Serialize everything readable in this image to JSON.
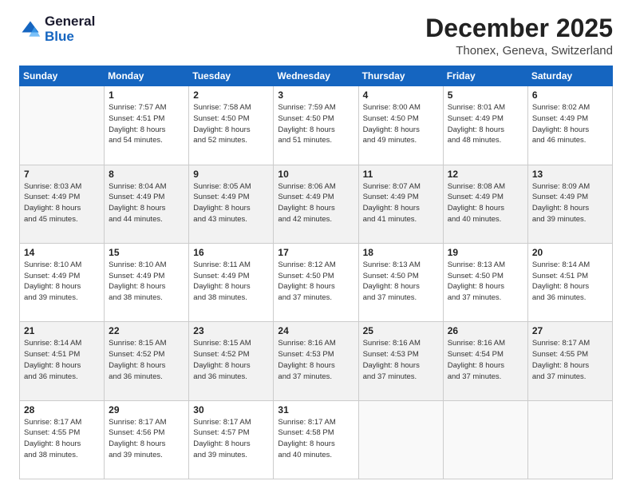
{
  "header": {
    "logo_line1": "General",
    "logo_line2": "Blue",
    "month_title": "December 2025",
    "subtitle": "Thonex, Geneva, Switzerland"
  },
  "weekdays": [
    "Sunday",
    "Monday",
    "Tuesday",
    "Wednesday",
    "Thursday",
    "Friday",
    "Saturday"
  ],
  "weeks": [
    [
      {
        "day": "",
        "info": ""
      },
      {
        "day": "1",
        "info": "Sunrise: 7:57 AM\nSunset: 4:51 PM\nDaylight: 8 hours\nand 54 minutes."
      },
      {
        "day": "2",
        "info": "Sunrise: 7:58 AM\nSunset: 4:50 PM\nDaylight: 8 hours\nand 52 minutes."
      },
      {
        "day": "3",
        "info": "Sunrise: 7:59 AM\nSunset: 4:50 PM\nDaylight: 8 hours\nand 51 minutes."
      },
      {
        "day": "4",
        "info": "Sunrise: 8:00 AM\nSunset: 4:50 PM\nDaylight: 8 hours\nand 49 minutes."
      },
      {
        "day": "5",
        "info": "Sunrise: 8:01 AM\nSunset: 4:49 PM\nDaylight: 8 hours\nand 48 minutes."
      },
      {
        "day": "6",
        "info": "Sunrise: 8:02 AM\nSunset: 4:49 PM\nDaylight: 8 hours\nand 46 minutes."
      }
    ],
    [
      {
        "day": "7",
        "info": "Sunrise: 8:03 AM\nSunset: 4:49 PM\nDaylight: 8 hours\nand 45 minutes."
      },
      {
        "day": "8",
        "info": "Sunrise: 8:04 AM\nSunset: 4:49 PM\nDaylight: 8 hours\nand 44 minutes."
      },
      {
        "day": "9",
        "info": "Sunrise: 8:05 AM\nSunset: 4:49 PM\nDaylight: 8 hours\nand 43 minutes."
      },
      {
        "day": "10",
        "info": "Sunrise: 8:06 AM\nSunset: 4:49 PM\nDaylight: 8 hours\nand 42 minutes."
      },
      {
        "day": "11",
        "info": "Sunrise: 8:07 AM\nSunset: 4:49 PM\nDaylight: 8 hours\nand 41 minutes."
      },
      {
        "day": "12",
        "info": "Sunrise: 8:08 AM\nSunset: 4:49 PM\nDaylight: 8 hours\nand 40 minutes."
      },
      {
        "day": "13",
        "info": "Sunrise: 8:09 AM\nSunset: 4:49 PM\nDaylight: 8 hours\nand 39 minutes."
      }
    ],
    [
      {
        "day": "14",
        "info": "Sunrise: 8:10 AM\nSunset: 4:49 PM\nDaylight: 8 hours\nand 39 minutes."
      },
      {
        "day": "15",
        "info": "Sunrise: 8:10 AM\nSunset: 4:49 PM\nDaylight: 8 hours\nand 38 minutes."
      },
      {
        "day": "16",
        "info": "Sunrise: 8:11 AM\nSunset: 4:49 PM\nDaylight: 8 hours\nand 38 minutes."
      },
      {
        "day": "17",
        "info": "Sunrise: 8:12 AM\nSunset: 4:50 PM\nDaylight: 8 hours\nand 37 minutes."
      },
      {
        "day": "18",
        "info": "Sunrise: 8:13 AM\nSunset: 4:50 PM\nDaylight: 8 hours\nand 37 minutes."
      },
      {
        "day": "19",
        "info": "Sunrise: 8:13 AM\nSunset: 4:50 PM\nDaylight: 8 hours\nand 37 minutes."
      },
      {
        "day": "20",
        "info": "Sunrise: 8:14 AM\nSunset: 4:51 PM\nDaylight: 8 hours\nand 36 minutes."
      }
    ],
    [
      {
        "day": "21",
        "info": "Sunrise: 8:14 AM\nSunset: 4:51 PM\nDaylight: 8 hours\nand 36 minutes."
      },
      {
        "day": "22",
        "info": "Sunrise: 8:15 AM\nSunset: 4:52 PM\nDaylight: 8 hours\nand 36 minutes."
      },
      {
        "day": "23",
        "info": "Sunrise: 8:15 AM\nSunset: 4:52 PM\nDaylight: 8 hours\nand 36 minutes."
      },
      {
        "day": "24",
        "info": "Sunrise: 8:16 AM\nSunset: 4:53 PM\nDaylight: 8 hours\nand 37 minutes."
      },
      {
        "day": "25",
        "info": "Sunrise: 8:16 AM\nSunset: 4:53 PM\nDaylight: 8 hours\nand 37 minutes."
      },
      {
        "day": "26",
        "info": "Sunrise: 8:16 AM\nSunset: 4:54 PM\nDaylight: 8 hours\nand 37 minutes."
      },
      {
        "day": "27",
        "info": "Sunrise: 8:17 AM\nSunset: 4:55 PM\nDaylight: 8 hours\nand 37 minutes."
      }
    ],
    [
      {
        "day": "28",
        "info": "Sunrise: 8:17 AM\nSunset: 4:55 PM\nDaylight: 8 hours\nand 38 minutes."
      },
      {
        "day": "29",
        "info": "Sunrise: 8:17 AM\nSunset: 4:56 PM\nDaylight: 8 hours\nand 39 minutes."
      },
      {
        "day": "30",
        "info": "Sunrise: 8:17 AM\nSunset: 4:57 PM\nDaylight: 8 hours\nand 39 minutes."
      },
      {
        "day": "31",
        "info": "Sunrise: 8:17 AM\nSunset: 4:58 PM\nDaylight: 8 hours\nand 40 minutes."
      },
      {
        "day": "",
        "info": ""
      },
      {
        "day": "",
        "info": ""
      },
      {
        "day": "",
        "info": ""
      }
    ]
  ]
}
